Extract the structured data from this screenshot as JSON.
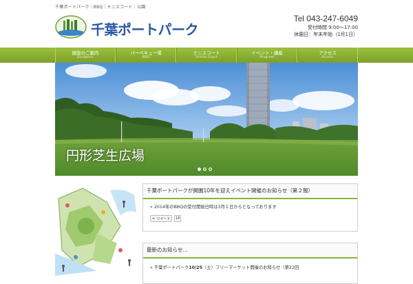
{
  "header": {
    "tagline": "千葉ポートパーク｜BBQ｜テニスコート｜公園",
    "logo_text": "千葉ポートパーク",
    "tel": "Tel 043-247-6049",
    "hours": "受付時間 9:00～17:00",
    "closed": "休園日：年末年始（1月1日）"
  },
  "nav": [
    {
      "jp": "施設のご案内",
      "en": "Guidance"
    },
    {
      "jp": "バーベキュー場",
      "en": "BBQ"
    },
    {
      "jp": "テニスコート",
      "en": "Tennis Court"
    },
    {
      "jp": "イベント・講座",
      "en": "Program"
    },
    {
      "jp": "アクセス",
      "en": "Access"
    }
  ],
  "hero": {
    "caption": "円形芝生広場",
    "slides": 3,
    "active_slide": 1
  },
  "content": {
    "box1_title": "千葉ポートパークが開園10年を迎えイベント開催のお知らせ（第２報）",
    "box1_text": "» 2014年のBBQの受付開始日時は3月１日からとなっております",
    "tweet_label": "ツイート",
    "tweet_count": "18",
    "box2_title": "最新のお知らせ…",
    "box2_text_prefix": "» 千葉ポートパーク",
    "box2_text_bold": "10/25",
    "box2_text_suffix": "（土）フリーマーケット開催のお知らせ（第22回"
  },
  "colors": {
    "nav_green": "#8db33a",
    "logo_blue": "#2b57a6",
    "tw_blue": "#1da1f2"
  }
}
